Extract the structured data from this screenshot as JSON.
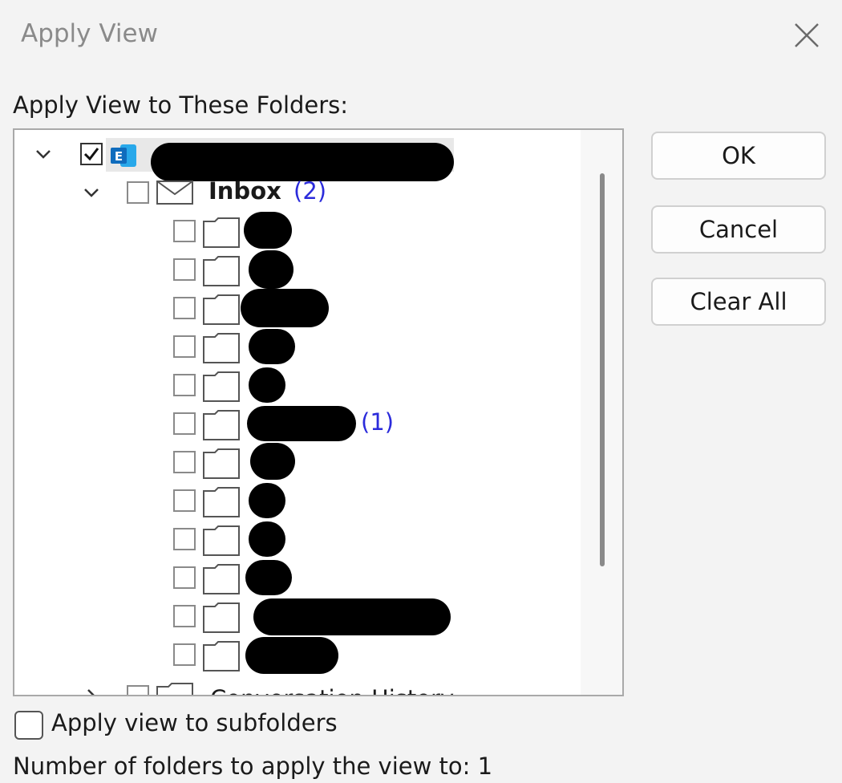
{
  "window": {
    "title": "Apply View"
  },
  "section_label": "Apply View to These Folders:",
  "tree": {
    "inbox": {
      "label": "Inbox",
      "count": "(2)"
    },
    "subfolder_count": "(1)",
    "partial_row_label": "Conversation History"
  },
  "buttons": {
    "ok": "OK",
    "cancel": "Cancel",
    "clear_all": "Clear All"
  },
  "subfolders_option": {
    "label": "Apply view to subfolders",
    "checked": false
  },
  "status": {
    "count_text": "Number of folders to apply the view to: 1"
  },
  "icons": {
    "close": "close-icon",
    "chevron": "chevron-down-icon",
    "exchange": "exchange-account-icon",
    "mail": "mail-icon",
    "folder": "folder-icon"
  },
  "colors": {
    "accent": "#0f6cbd",
    "count": "#2b2bdb"
  }
}
